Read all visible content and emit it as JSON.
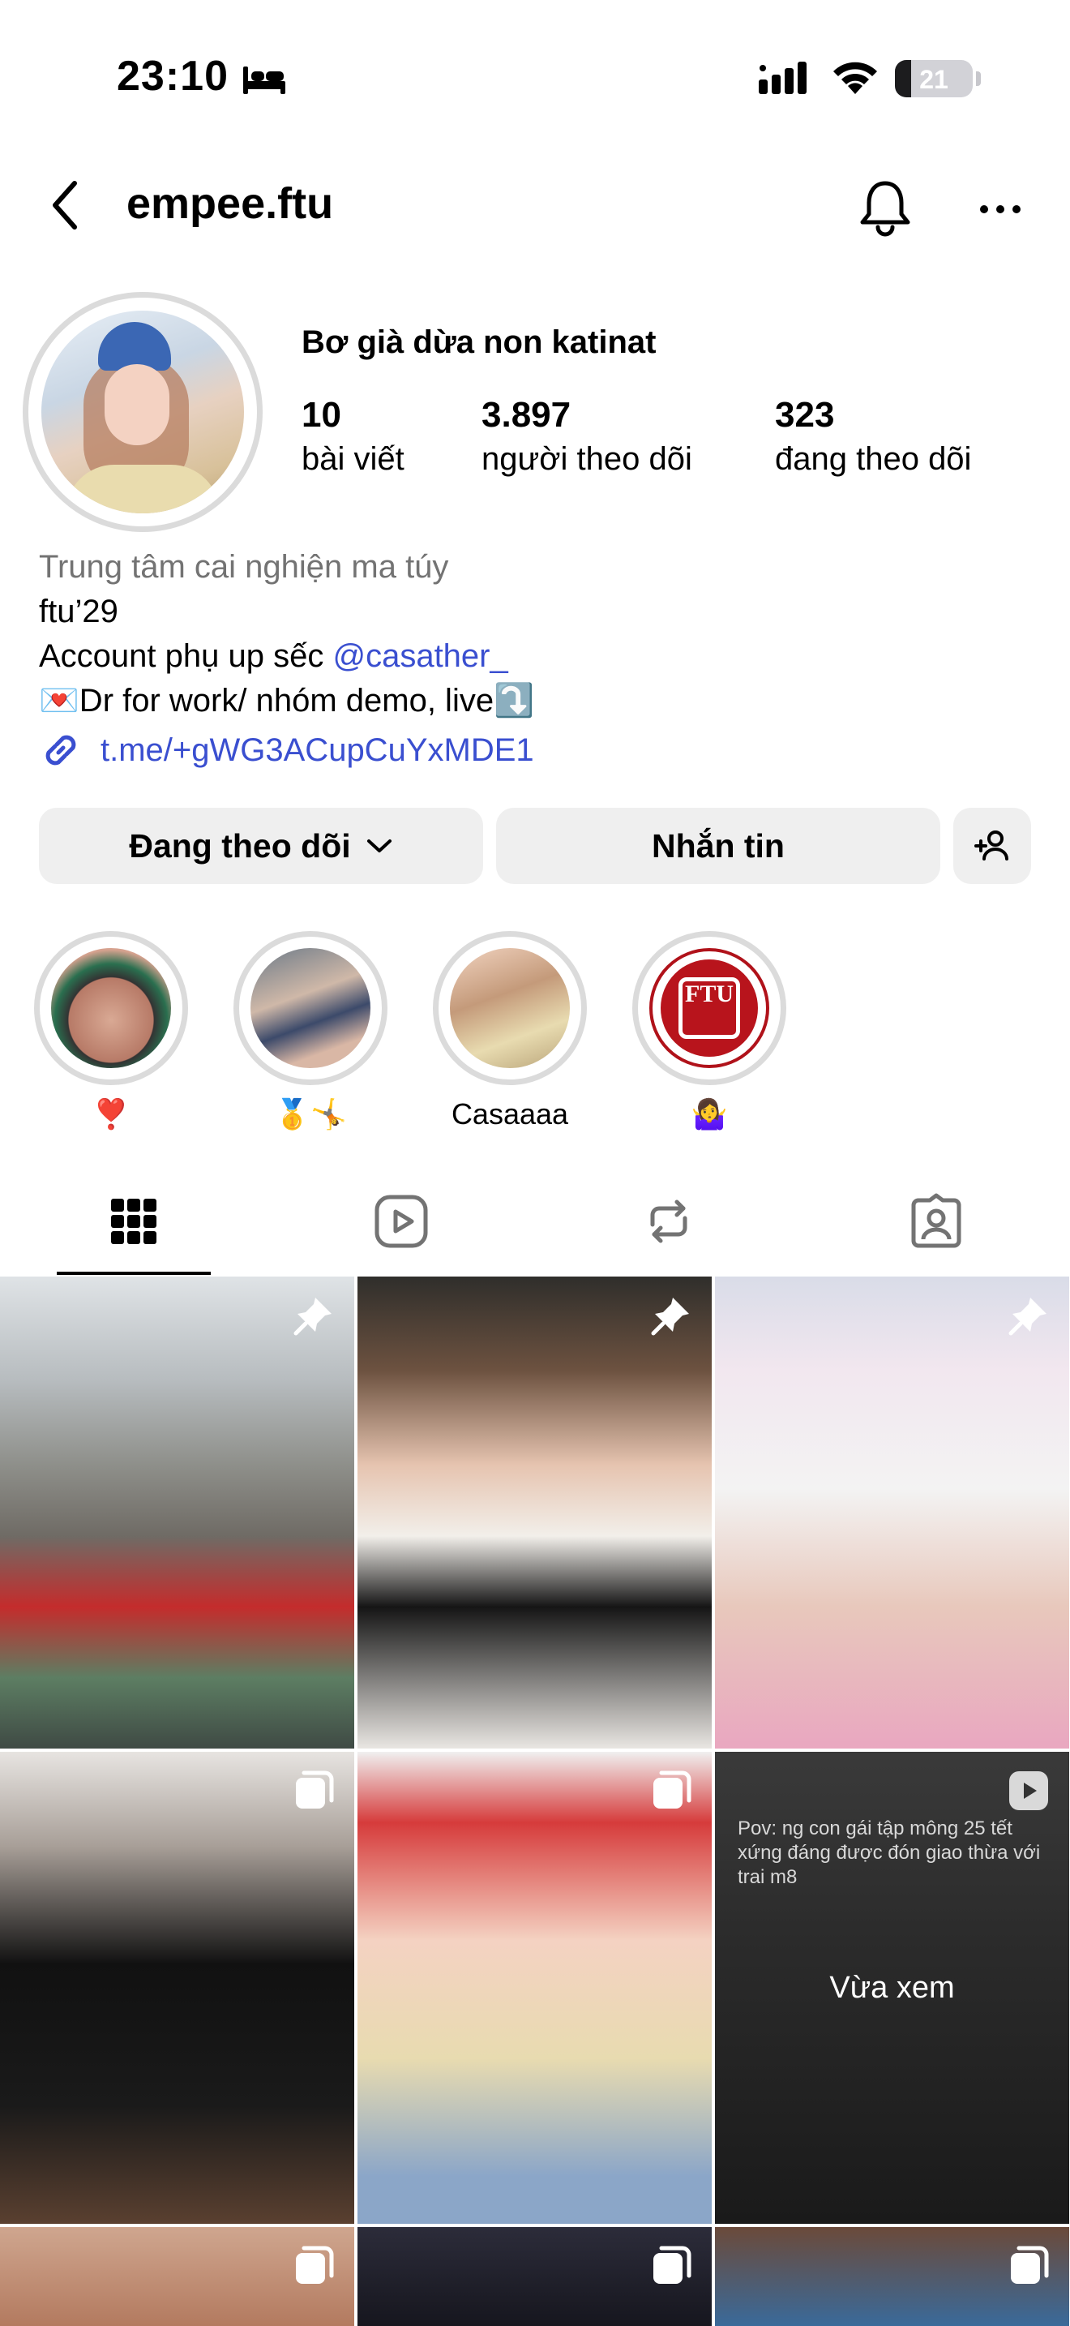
{
  "status_bar": {
    "time": "23:10",
    "battery": "21",
    "battery_level": 0.21,
    "mode_icon": "bed-icon"
  },
  "nav": {
    "username": "empee.ftu",
    "icons": [
      "chevron-left-icon",
      "bell-icon",
      "more-horizontal-icon"
    ]
  },
  "profile": {
    "display_name": "Bơ già dừa non katinat",
    "stats": {
      "posts": {
        "count": "10",
        "label": "bài viết"
      },
      "followers": {
        "count": "3.897",
        "label": "người theo dõi"
      },
      "following": {
        "count": "323",
        "label": "đang theo dõi"
      }
    },
    "bio": {
      "category": "Trung tâm cai nghiện ma túy",
      "line1": "ftu’29",
      "line2_prefix": "Account phụ up sếc ",
      "line2_mention": "@casather_",
      "line3": "💌Dr for work/ nhóm demo, live⤵️",
      "link": "t.me/+gWG3ACupCuYxMDE1"
    }
  },
  "actions": {
    "following_label": "Đang theo dõi",
    "message_label": "Nhắn tin"
  },
  "highlights": [
    {
      "label": "❣️"
    },
    {
      "label": "🥇🤸"
    },
    {
      "label": "Casaaaa"
    },
    {
      "label": "🤷‍♀️"
    }
  ],
  "highlight_logo_text": "FTU",
  "tabs": [
    "grid-icon",
    "reels-icon",
    "reposts-icon",
    "tagged-icon"
  ],
  "grid": {
    "pinned_badge": "pin-icon",
    "multi_badge": "carousel-icon",
    "reel_badge": "reels-icon",
    "reel_caption": "Pov: ng con gái tập mông 25 tết xứng đáng được đón giao thừa với trai m8",
    "reel_overlay": "Vừa xem"
  },
  "colors": {
    "link": "#3a4fd0",
    "secondary_text": "#737373",
    "button_bg": "#efefef"
  }
}
